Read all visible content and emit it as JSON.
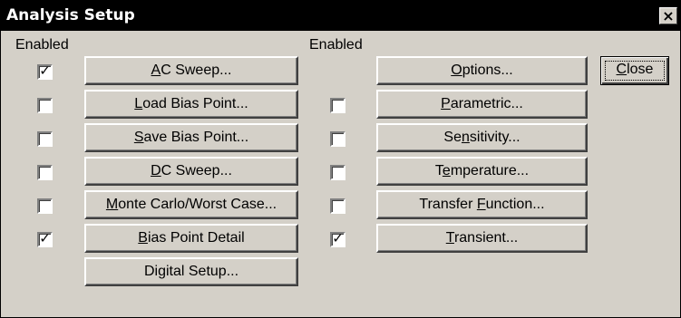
{
  "window": {
    "title": "Analysis Setup",
    "close_glyph": "×"
  },
  "columns": {
    "left_header": "Enabled",
    "right_header": "Enabled"
  },
  "left_items": [
    {
      "label": "AC Sweep...",
      "mnemonic": "A",
      "enabled": true
    },
    {
      "label": "Load Bias Point...",
      "mnemonic": "L",
      "enabled": false
    },
    {
      "label": "Save Bias Point...",
      "mnemonic": "S",
      "enabled": false
    },
    {
      "label": "DC Sweep...",
      "mnemonic": "D",
      "enabled": false
    },
    {
      "label": "Monte Carlo/Worst Case...",
      "mnemonic": "M",
      "enabled": false
    },
    {
      "label": "Bias Point Detail",
      "mnemonic": "B",
      "enabled": true
    },
    {
      "label": "Digital Setup...",
      "mnemonic": "",
      "enabled": null
    }
  ],
  "right_items": [
    {
      "label": "Options...",
      "mnemonic": "O",
      "enabled": null
    },
    {
      "label": "Parametric...",
      "mnemonic": "P",
      "enabled": false
    },
    {
      "label": "Sensitivity...",
      "mnemonic": "n",
      "enabled": false
    },
    {
      "label": "Temperature...",
      "mnemonic": "e",
      "enabled": false
    },
    {
      "label": "Transfer Function...",
      "mnemonic": "F",
      "enabled": false
    },
    {
      "label": "Transient...",
      "mnemonic": "T",
      "enabled": true
    }
  ],
  "close_button": {
    "label": "Close",
    "mnemonic": "C"
  },
  "check_glyph": "✓"
}
